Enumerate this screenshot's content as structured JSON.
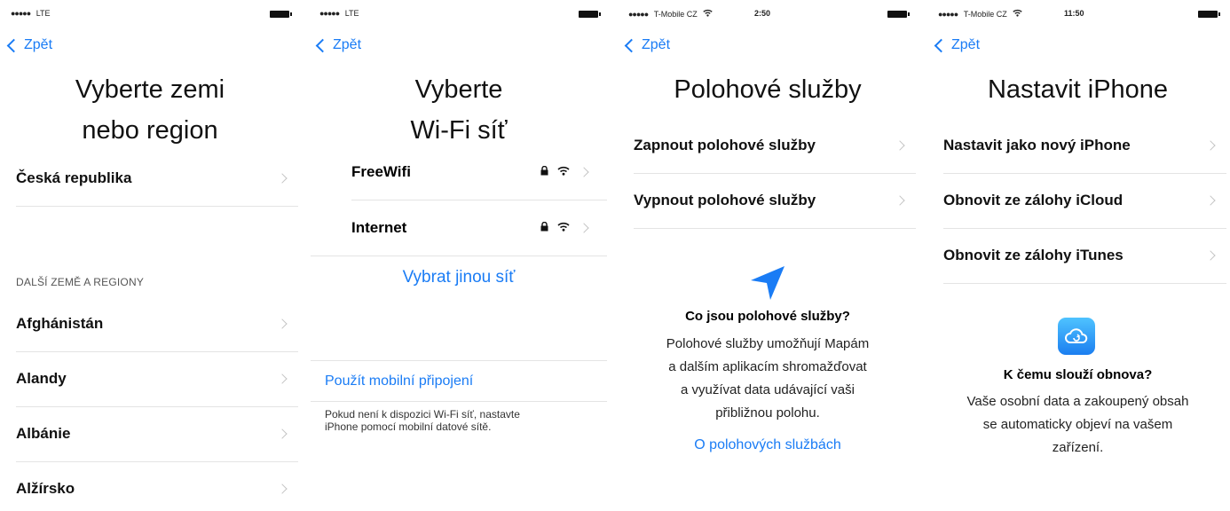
{
  "screens": [
    {
      "status": {
        "dots": "●●●●●",
        "carrier": "LTE",
        "time": ""
      },
      "back": "Zpět",
      "title": [
        "Vyberte zemi",
        "nebo region"
      ],
      "top_rows": [
        "Česká republika"
      ],
      "section_header": "DALŠÍ ZEMĚ A REGIONY",
      "rows": [
        "Afghánistán",
        "Alandy",
        "Albánie",
        "Alžírsko"
      ]
    },
    {
      "status": {
        "dots": "●●●●●",
        "carrier": "LTE",
        "time": ""
      },
      "back": "Zpět",
      "title": [
        "Vyberte",
        "Wi-Fi síť"
      ],
      "networks": [
        "FreeWifi",
        "Internet"
      ],
      "other_network": "Vybrat jinou síť",
      "mobile_link": "Použít mobilní připojení",
      "footnote": [
        "Pokud není k dispozici Wi-Fi síť, nastavte",
        "iPhone pomocí mobilní datové sítě."
      ]
    },
    {
      "status": {
        "dots": "●●●●●",
        "carrier": "T-Mobile CZ",
        "time": "2:50"
      },
      "back": "Zpět",
      "title": [
        "Polohové služby"
      ],
      "rows": [
        "Zapnout polohové služby",
        "Vypnout polohové služby"
      ],
      "info_head": "Co jsou polohové služby?",
      "info_body": [
        "Polohové služby umožňují Mapám",
        "a dalším aplikacím shromažďovat",
        "a využívat data udávající vaši",
        "přibližnou polohu."
      ],
      "info_link": "O polohových službách"
    },
    {
      "status": {
        "dots": "●●●●●",
        "carrier": "T-Mobile CZ",
        "time": "11:50"
      },
      "back": "Zpět",
      "title": [
        "Nastavit iPhone"
      ],
      "rows": [
        "Nastavit jako nový iPhone",
        "Obnovit ze zálohy iCloud",
        "Obnovit ze zálohy iTunes"
      ],
      "info_head": "K čemu slouží obnova?",
      "info_body": [
        "Vaše osobní data a zakoupený obsah",
        "se automaticky objeví na vašem",
        "zařízení."
      ]
    }
  ],
  "colors": {
    "accent": "#1a7cf5",
    "separator": "#e4e4e4",
    "chevron": "#c4c4c4"
  },
  "icons": [
    "chevron-left-icon",
    "chevron-right-icon",
    "lock-icon",
    "wifi-icon",
    "location-arrow-icon",
    "icloud-icon",
    "battery-icon"
  ]
}
